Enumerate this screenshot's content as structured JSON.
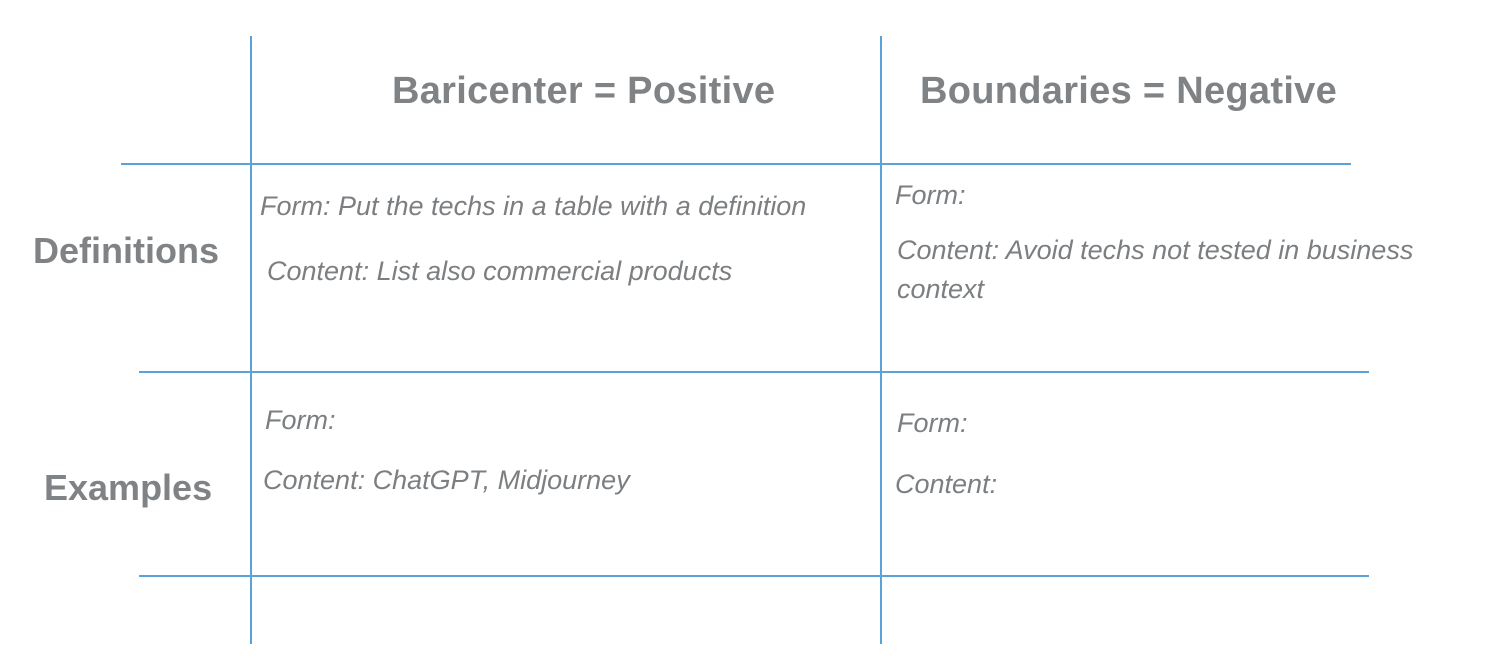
{
  "columns": {
    "positive": "Baricenter = Positive",
    "negative": "Boundaries = Negative"
  },
  "rows": {
    "definitions": "Definitions",
    "examples": "Examples"
  },
  "cells": {
    "definitions_positive": {
      "form": "Form: Put the techs in a table with a definition",
      "content": "Content: List also commercial products"
    },
    "definitions_negative": {
      "form": "Form:",
      "content_line1": "Content: Avoid techs not tested in business",
      "content_line2": "context"
    },
    "examples_positive": {
      "form": "Form:",
      "content": "Content: ChatGPT, Midjourney"
    },
    "examples_negative": {
      "form": "Form:",
      "content": "Content:"
    }
  },
  "colors": {
    "grid_line": "#5aa2d8",
    "text": "#7c7f82"
  }
}
